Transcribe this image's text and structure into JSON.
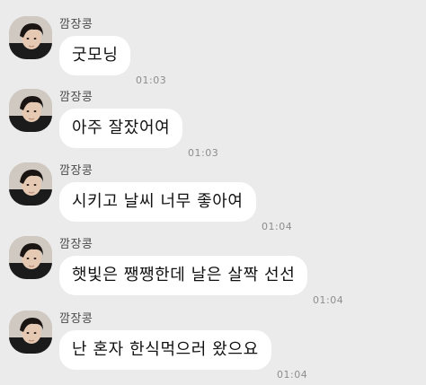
{
  "messages": [
    {
      "sender": "깜장콩",
      "text": "굿모닝",
      "time": "01:03"
    },
    {
      "sender": "깜장콩",
      "text": "아주 잘잤어여",
      "time": "01:03"
    },
    {
      "sender": "깜장콩",
      "text": "시키고 날씨 너무 좋아여",
      "time": "01:04"
    },
    {
      "sender": "깜장콩",
      "text": "햇빛은 쨍쨍한데 날은 살짝 선선",
      "time": "01:04"
    },
    {
      "sender": "깜장콩",
      "text": "난 혼자 한식먹으러 왔으요",
      "time": "01:04"
    }
  ],
  "colors": {
    "background": "#ebebeb",
    "bubble": "#ffffff",
    "text": "#111111",
    "sender": "#4a4a4a",
    "time": "#8d8d8d"
  },
  "icons": {
    "avatar": "profile-photo"
  }
}
